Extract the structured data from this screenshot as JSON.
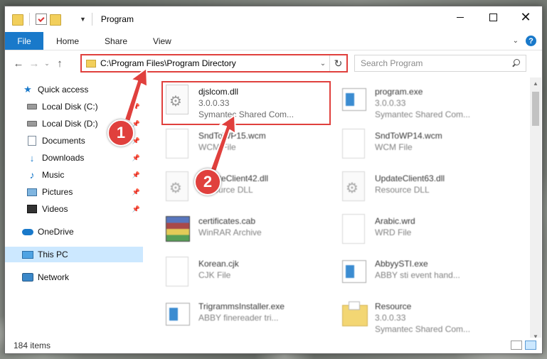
{
  "window": {
    "title": "Program"
  },
  "ribbon": {
    "tabs": [
      "File",
      "Home",
      "Share",
      "View"
    ],
    "help_glyph": "?"
  },
  "address": {
    "path": "C:\\Program Files\\Program Directory"
  },
  "search": {
    "placeholder": "Search Program"
  },
  "sidebar": {
    "items": [
      {
        "label": "Quick access",
        "icon": "star-icon"
      },
      {
        "label": "Local Disk (C:)",
        "icon": "disk-icon"
      },
      {
        "label": "Local Disk (D:)",
        "icon": "disk-icon"
      },
      {
        "label": "Documents",
        "icon": "documents-icon"
      },
      {
        "label": "Downloads",
        "icon": "downloads-icon"
      },
      {
        "label": "Music",
        "icon": "music-icon"
      },
      {
        "label": "Pictures",
        "icon": "pictures-icon"
      },
      {
        "label": "Videos",
        "icon": "videos-icon"
      },
      {
        "label": "OneDrive",
        "icon": "cloud-icon"
      },
      {
        "label": "This PC",
        "icon": "pc-icon"
      },
      {
        "label": "Network",
        "icon": "network-icon"
      }
    ]
  },
  "files": [
    {
      "name": "djslcom.dll",
      "line2": "3.0.0.33",
      "line3": "Symantec Shared Com..."
    },
    {
      "name": "program.exe",
      "line2": "3.0.0.33",
      "line3": "Symantec Shared Com..."
    },
    {
      "name": "SndToWP15.wcm",
      "line2": "WCM File",
      "line3": ""
    },
    {
      "name": "SndToWP14.wcm",
      "line2": "WCM File",
      "line3": ""
    },
    {
      "name": "UpdateClient42.dll",
      "line2": "Resource DLL",
      "line3": ""
    },
    {
      "name": "UpdateClient63.dll",
      "line2": "Resource DLL",
      "line3": ""
    },
    {
      "name": "certificates.cab",
      "line2": "WinRAR Archive",
      "line3": ""
    },
    {
      "name": "Arabic.wrd",
      "line2": "WRD File",
      "line3": ""
    },
    {
      "name": "Korean.cjk",
      "line2": "CJK File",
      "line3": ""
    },
    {
      "name": "AbbyySTI.exe",
      "line2": "ABBY sti event hand...",
      "line3": ""
    },
    {
      "name": "TrigrammsInstaller.exe",
      "line2": "ABBY finereader tri...",
      "line3": ""
    },
    {
      "name": "Resource",
      "line2": "3.0.0.33",
      "line3": "Symantec Shared Com..."
    }
  ],
  "status": {
    "item_count": "184 items"
  },
  "annotations": {
    "badge1": "1",
    "badge2": "2",
    "color": "#e0403d"
  }
}
